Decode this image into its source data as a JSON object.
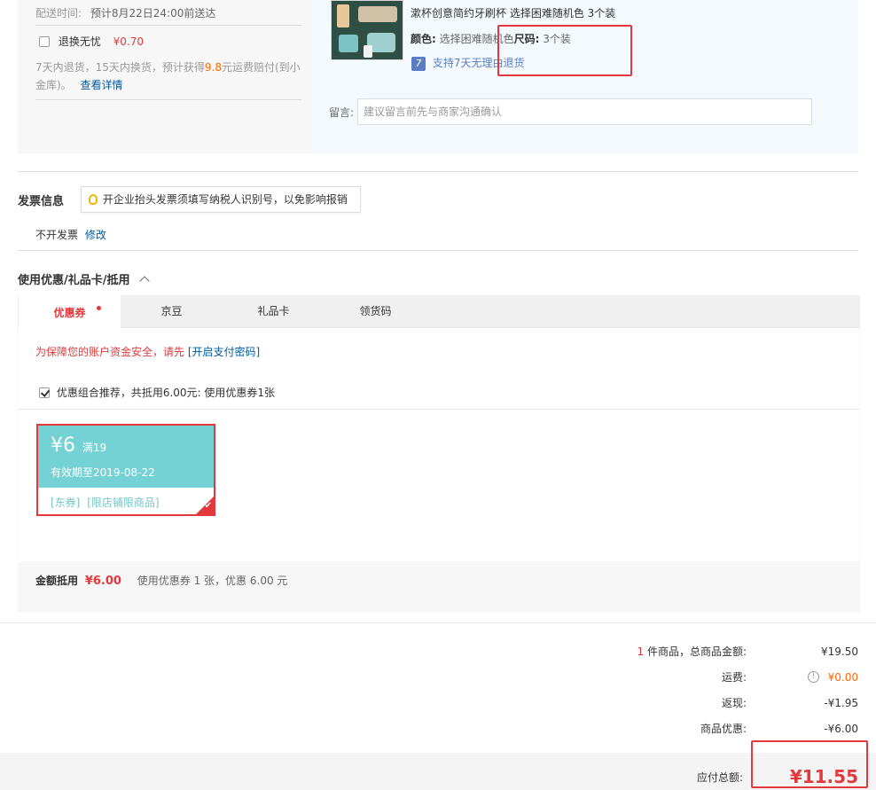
{
  "delivery": {
    "time_label": "配送时间:",
    "time_value": "预计8月22日24:00前送达",
    "insurance_label": "退换无忧",
    "insurance_price": "¥0.70",
    "insurance_desc_1": "7天内退货，15天内换货，预计获得",
    "insurance_amount": "9.8",
    "insurance_desc_2": "元运费赔付(到小",
    "insurance_desc_3": "金库)。",
    "insurance_link": "查看详情"
  },
  "product": {
    "name_line": "漱杯创意简约牙刷杯 选择困难随机色 3个装",
    "color_label": "颜色:",
    "color_value": "选择困难随机色",
    "size_label": "尺码:",
    "size_value": "3个装",
    "return_badge": "7",
    "return_text": "支持7天无理由退货",
    "remark_label": "留言:",
    "remark_placeholder": "建议留言前先与商家沟通确认"
  },
  "invoice": {
    "title": "发票信息",
    "tip": "开企业抬头发票须填写纳税人识别号，以免影响报销",
    "status": "不开发票",
    "modify_link": "修改"
  },
  "discount": {
    "title": "使用优惠/礼品卡/抵用",
    "tabs": [
      "优惠券",
      "京豆",
      "礼品卡",
      "领货码"
    ],
    "security_notice": "为保障您的账户资金安全，请先",
    "security_link": "[开启支付密码]",
    "combo_label": "优惠组合推荐，共抵用6.00元: 使用优惠券1张",
    "coupon": {
      "amount": "¥6",
      "threshold": "满19",
      "validity": "有效期至2019-08-22",
      "tag_1": "[东券]",
      "tag_2": "[限店铺限商品]"
    },
    "amount_label": "金额抵用",
    "amount_value": "¥6.00",
    "amount_desc": "使用优惠券 1 张，优惠 6.00 元"
  },
  "summary": {
    "items_count": "1",
    "items_label": "件商品，总商品金额:",
    "items_value": "¥19.50",
    "shipping_label": "运费:",
    "shipping_value": "¥0.00",
    "cashback_label": "返现:",
    "cashback_value": "-¥1.95",
    "product_discount_label": "商品优惠:",
    "product_discount_value": "-¥6.00",
    "total_label": "应付总额:",
    "total_value": "¥11.55"
  },
  "colors": {
    "accent_red": "#e4393c",
    "coupon_teal": "#74d2d4",
    "link_blue": "#005aa0"
  }
}
